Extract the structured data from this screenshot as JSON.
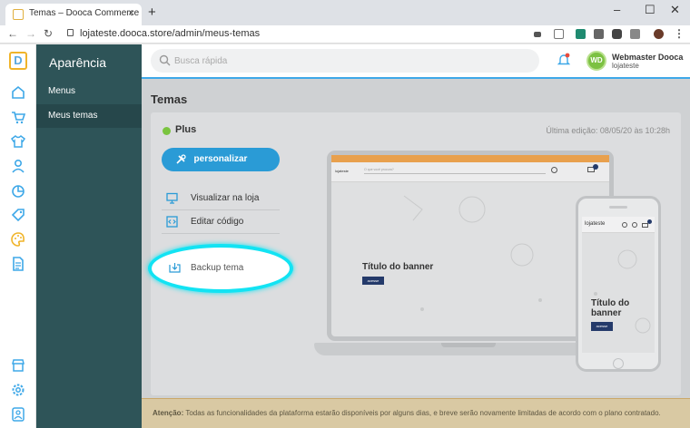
{
  "browser": {
    "tab_title": "Temas – Dooca Commerce",
    "tab_close": "×",
    "new_tab": "+",
    "url": "lojateste.dooca.store/admin/meus-temas",
    "nav": {
      "back": "←",
      "forward": "→",
      "reload": "↻"
    },
    "window_controls": {
      "minimize": "–",
      "maximize": "☐",
      "close": "✕"
    }
  },
  "app": {
    "logo_letter": "D",
    "brand_color": "#f0b42a",
    "accent_color": "#2a9bd6",
    "nav_icons": [
      "home-icon",
      "cart-icon",
      "shirt-icon",
      "user-icon",
      "chart-icon",
      "tag-icon",
      "palette-icon",
      "document-icon",
      "store-icon",
      "gear-icon",
      "account-icon"
    ]
  },
  "subnav": {
    "title": "Aparência",
    "items": [
      {
        "label": "Menus",
        "active": false
      },
      {
        "label": "Meus temas",
        "active": true
      }
    ]
  },
  "topbar": {
    "search_placeholder": "Busca rápida",
    "user_initials": "WD",
    "user_name": "Webmaster Dooca",
    "user_store": "lojateste"
  },
  "page": {
    "title": "Temas",
    "theme_name": "Plus",
    "last_edit": "Última edição: 08/05/20 às 10:28h",
    "customize_label": "personalizar",
    "menu": [
      {
        "label": "Visualizar na loja",
        "icon": "monitor-icon"
      },
      {
        "label": "Editar código",
        "icon": "code-icon"
      },
      {
        "label": "Backup tema",
        "icon": "download-icon"
      }
    ]
  },
  "preview": {
    "laptop_store": "lojateste",
    "laptop_search_placeholder": "O que você procura?",
    "banner_title": "Título do banner",
    "banner_button": "acesse",
    "phone_store": "lojateste",
    "phone_banner_title": "Título do banner"
  },
  "alert": {
    "label": "Atenção:",
    "text": " Todas as funcionalidades da plataforma estarão disponíveis por alguns dias, e breve serão novamente limitadas de acordo com o plano contratado."
  }
}
